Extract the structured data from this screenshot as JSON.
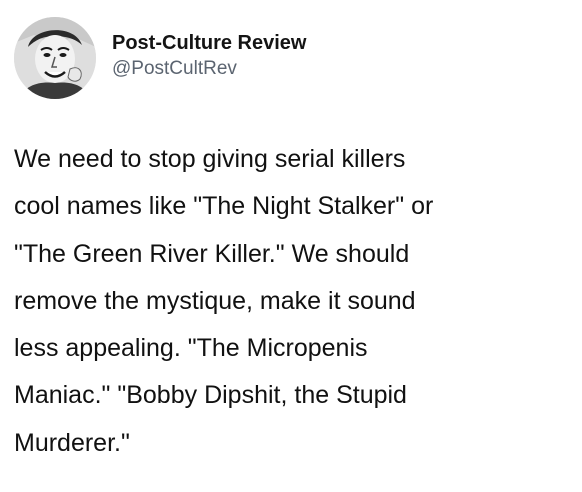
{
  "account": {
    "display_name": "Post-Culture Review",
    "handle": "@PostCultRev",
    "avatar_icon": "profile-photo-avatar"
  },
  "tweet": {
    "lines": [
      "We need to stop giving serial killers",
      "cool names like \"The Night Stalker\" or",
      "\"The Green River Killer.\" We should",
      "remove the mystique, make it sound",
      "less appealing. \"The Micropenis",
      "Maniac.\" \"Bobby Dipshit, the Stupid",
      "Murderer.\""
    ]
  },
  "colors": {
    "background": "#ffffff",
    "text": "#111111",
    "handle": "#5b6470"
  }
}
